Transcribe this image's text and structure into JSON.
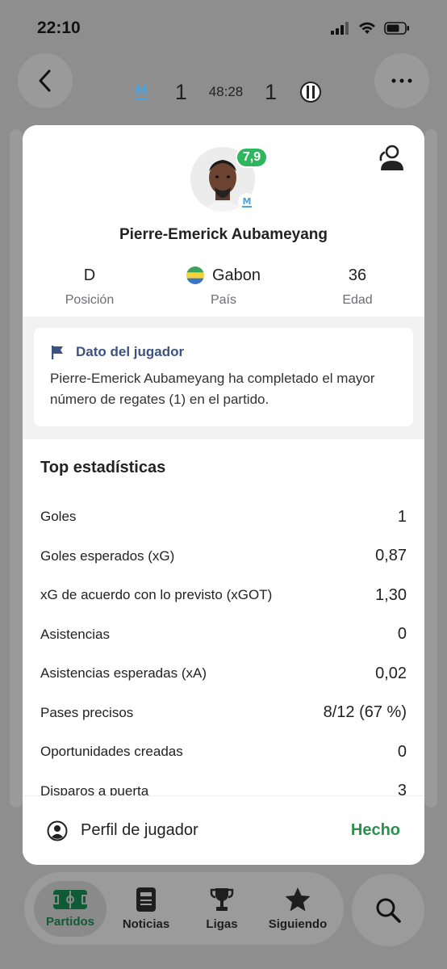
{
  "status_bar": {
    "time": "22:10"
  },
  "match": {
    "home_score": "1",
    "clock": "48:28",
    "away_score": "1"
  },
  "player": {
    "rating": "7,9",
    "name": "Pierre-Emerick Aubameyang",
    "position_value": "D",
    "position_label": "Posición",
    "country_value": "Gabon",
    "country_label": "País",
    "age_value": "36",
    "age_label": "Edad"
  },
  "fact": {
    "title": "Dato del jugador",
    "text": "Pierre-Emerick Aubameyang ha completado el mayor número de regates (1) en el partido."
  },
  "stats": {
    "title": "Top estadísticas",
    "rows": [
      {
        "label": "Goles",
        "value": "1"
      },
      {
        "label": "Goles esperados (xG)",
        "value": "0,87"
      },
      {
        "label": "xG de acuerdo con lo previsto (xGOT)",
        "value": "1,30"
      },
      {
        "label": "Asistencias",
        "value": "0"
      },
      {
        "label": "Asistencias esperadas (xA)",
        "value": "0,02"
      },
      {
        "label": "Pases precisos",
        "value": "8/12 (67 %)"
      },
      {
        "label": "Oportunidades creadas",
        "value": "0"
      },
      {
        "label": "Disparos a puerta",
        "value": "3"
      }
    ]
  },
  "footer": {
    "profile_label": "Perfil de jugador",
    "done_label": "Hecho"
  },
  "nav": {
    "items": [
      {
        "label": "Partidos",
        "icon": "pitch-icon"
      },
      {
        "label": "Noticias",
        "icon": "news-icon"
      },
      {
        "label": "Ligas",
        "icon": "trophy-icon"
      },
      {
        "label": "Siguiendo",
        "icon": "star-icon"
      }
    ]
  },
  "colors": {
    "accent_green": "#2fb55e",
    "done_green": "#2b8f4d",
    "fact_blue": "#3c5380"
  }
}
